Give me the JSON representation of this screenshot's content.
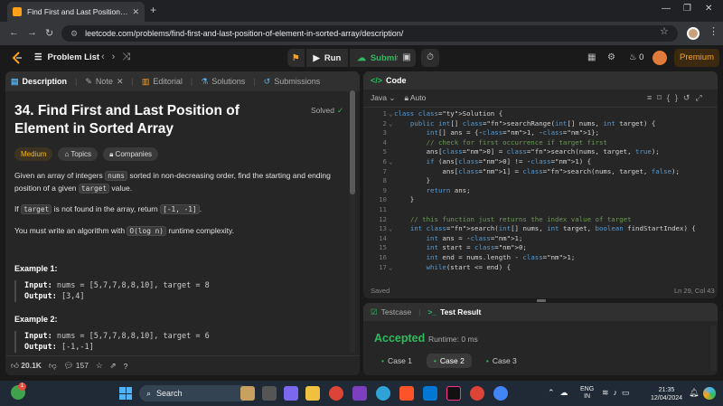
{
  "browser": {
    "tab_title": "Find First and Last Position of E",
    "url": "leetcode.com/problems/find-first-and-last-position-of-element-in-sorted-array/description/"
  },
  "nav": {
    "problem_list": "Problem List",
    "run": "Run",
    "submit": "Submit",
    "streak": "0",
    "premium": "Premium"
  },
  "left_tabs": [
    {
      "label": "Description"
    },
    {
      "label": "Note"
    },
    {
      "label": "Editorial"
    },
    {
      "label": "Solutions"
    },
    {
      "label": "Submissions"
    }
  ],
  "problem": {
    "title": "34. Find First and Last Position of Element in Sorted Array",
    "solved": "Solved",
    "tags": [
      "Medium",
      "Topics",
      "Companies"
    ],
    "p1_a": "Given an array of integers ",
    "p1_code1": "nums",
    "p1_b": " sorted in non-decreasing order, find the starting and ending position of a given ",
    "p1_code2": "target",
    "p1_c": " value.",
    "p2_a": "If ",
    "p2_code1": "target",
    "p2_b": " is not found in the array, return ",
    "p2_code2": "[-1, -1]",
    "p2_c": ".",
    "p3_a": "You must write an algorithm with ",
    "p3_code": "O(log n)",
    "p3_b": " runtime complexity.",
    "ex1_title": "Example 1:",
    "ex1_input_label": "Input:",
    "ex1_input": " nums = [5,7,7,8,8,10], target = 8",
    "ex1_output_label": "Output:",
    "ex1_output": " [3,4]",
    "ex2_title": "Example 2:",
    "ex2_input_label": "Input:",
    "ex2_input": " nums = [5,7,7,8,8,10], target = 6",
    "ex2_output_label": "Output:",
    "ex2_output": " [-1,-1]"
  },
  "left_footer": {
    "likes": "20.1K",
    "comments": "157"
  },
  "code_panel": {
    "title": "Code",
    "language": "Java",
    "mode": "Auto",
    "status": "Saved",
    "cursor": "Ln 29, Col 43"
  },
  "code_lines": [
    "class Solution {",
    "    public int[] searchRange(int[] nums, int target) {",
    "        int[] ans = {-1, -1};",
    "        // check for first occurrence if target first",
    "        ans[0] = search(nums, target, true);",
    "        if (ans[0] != -1) {",
    "            ans[1] = search(nums, target, false);",
    "        }",
    "        return ans;",
    "    }",
    "",
    "    // this function just returns the index value of target",
    "    int search(int[] nums, int target, boolean findStartIndex) {",
    "        int ans = -1;",
    "        int start = 0;",
    "        int end = nums.length - 1;",
    "        while(start <= end) {"
  ],
  "test_panel": {
    "testcase_tab": "Testcase",
    "result_tab": "Test Result",
    "status": "Accepted",
    "runtime": "Runtime: 0 ms",
    "cases": [
      "Case 1",
      "Case 2",
      "Case 3"
    ]
  },
  "taskbar": {
    "search": "Search",
    "lang1": "ENG",
    "lang2": "IN",
    "time": "21:35",
    "date": "12/04/2024",
    "weather_badge": "1"
  },
  "colors": {
    "accent_green": "#2cbb5d",
    "accent_orange": "#ffa116",
    "medium_yellow": "#ffb800"
  }
}
